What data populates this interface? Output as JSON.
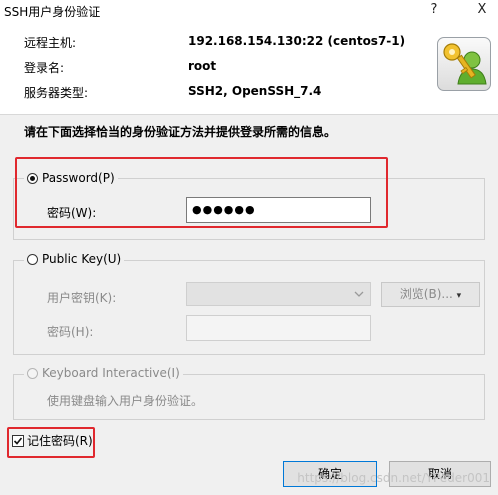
{
  "window": {
    "title": "SSH用户身份验证",
    "help_glyph": "?",
    "close_glyph": "X"
  },
  "info": {
    "host_label": "远程主机:",
    "host_value": "192.168.154.130:22 (centos7-1)",
    "login_label": "登录名:",
    "login_value": "root",
    "server_type_label": "服务器类型:",
    "server_type_value": "SSH2, OpenSSH_7.4"
  },
  "instruction": "请在下面选择恰当的身份验证方法并提供登录所需的信息。",
  "password_group": {
    "radio_label": "Password(P)",
    "field_label": "密码(W):",
    "field_value": "●●●●●●"
  },
  "publickey_group": {
    "radio_label": "Public Key(U)",
    "user_key_label": "用户密钥(K):",
    "browse_label": "浏览(B)...",
    "passphrase_label": "密码(H):"
  },
  "keyboard_group": {
    "radio_label": "Keyboard Interactive(I)",
    "description": "使用键盘输入用户身份验证。"
  },
  "remember": {
    "label": "记住密码(R)"
  },
  "buttons": {
    "ok": "确定",
    "cancel": "取消"
  },
  "watermark": "https://blog.csdn.net/YPeder001",
  "colors": {
    "highlight_red": "#e0282e",
    "window_bg": "#f0f0f0",
    "focus_blue": "#0078d7"
  },
  "icons": [
    "help-icon",
    "close-icon",
    "key-user-icon",
    "dropdown-arrow-icon"
  ]
}
